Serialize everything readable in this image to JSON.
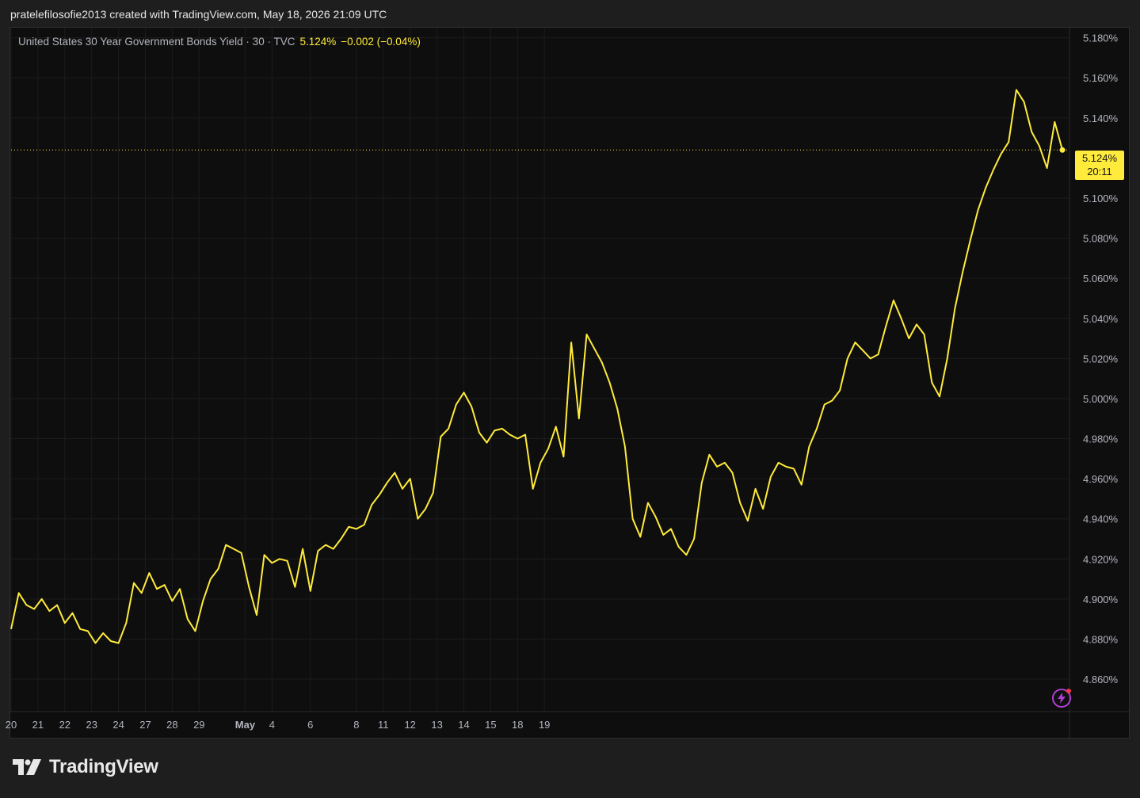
{
  "header": {
    "text": "pratelefilosofie2013 created with TradingView.com, May 18, 2026 21:09 UTC"
  },
  "legend": {
    "symbol": "United States 30 Year Government Bonds Yield · 30 · TVC",
    "last": "5.124%",
    "change": "−0.002 (−0.04%)"
  },
  "price_badge": {
    "price": "5.124%",
    "countdown": "20:11"
  },
  "brand": {
    "logo_text": "TradingView"
  },
  "colors": {
    "line": "#ffeb3b",
    "background": "#0e0e0e",
    "grid": "#1c1c1c",
    "axis_text": "#b2b5be"
  },
  "chart_data": {
    "type": "line",
    "title": "United States 30 Year Government Bonds Yield · 30 · TVC",
    "ylabel": "",
    "xlabel": "",
    "ylim": [
      4.845,
      5.185
    ],
    "grid": true,
    "y_ticks": [
      "5.180%",
      "5.160%",
      "5.140%",
      "5.100%",
      "5.080%",
      "5.060%",
      "5.040%",
      "5.020%",
      "5.000%",
      "4.980%",
      "4.960%",
      "4.940%",
      "4.920%",
      "4.900%",
      "4.880%",
      "4.860%"
    ],
    "y_tick_values": [
      5.18,
      5.16,
      5.14,
      5.1,
      5.08,
      5.06,
      5.04,
      5.02,
      5.0,
      4.98,
      4.96,
      4.94,
      4.92,
      4.9,
      4.88,
      4.86
    ],
    "x_ticks": [
      "20",
      "21",
      "22",
      "23",
      "24",
      "27",
      "28",
      "29",
      "May",
      "4",
      "6",
      "8",
      "11",
      "12",
      "13",
      "14",
      "15",
      "18",
      "19"
    ],
    "x_tick_index": [
      0,
      3.5,
      7,
      10.5,
      14,
      17.5,
      21,
      24.5,
      30.5,
      34,
      39,
      45,
      48.5,
      52,
      55.5,
      59,
      62.5,
      66,
      69.5
    ],
    "series": [
      {
        "values": [
          4.885,
          4.903,
          4.897,
          4.895,
          4.9,
          4.894,
          4.897,
          4.888,
          4.893,
          4.885,
          4.884,
          4.878,
          4.883,
          4.879,
          4.878,
          4.888,
          4.908,
          4.903,
          4.913,
          4.905,
          4.907,
          4.899,
          4.905,
          4.89,
          4.884,
          4.899,
          4.91,
          4.915,
          4.927,
          4.925,
          4.923,
          4.906,
          4.892,
          4.922,
          4.918,
          4.92,
          4.919,
          4.906,
          4.925,
          4.904,
          4.924,
          4.927,
          4.925,
          4.93,
          4.936,
          4.935,
          4.937,
          4.947,
          4.952,
          4.958,
          4.963,
          4.955,
          4.96,
          4.94,
          4.945,
          4.953,
          4.981,
          4.985,
          4.997,
          5.003,
          4.996,
          4.983,
          4.978,
          4.984,
          4.985,
          4.982,
          4.98,
          4.982,
          4.955,
          4.968,
          4.975,
          4.986,
          4.971,
          5.028,
          4.99,
          5.032,
          5.025,
          5.018,
          5.008,
          4.995,
          4.976,
          4.94,
          4.931,
          4.948,
          4.941,
          4.932,
          4.935,
          4.926,
          4.922,
          4.93,
          4.958,
          4.972,
          4.966,
          4.968,
          4.963,
          4.948,
          4.939,
          4.955,
          4.945,
          4.961,
          4.968,
          4.966,
          4.965,
          4.957,
          4.976,
          4.985,
          4.997,
          4.999,
          5.004,
          5.02,
          5.028,
          5.024,
          5.02,
          5.022,
          5.036,
          5.049,
          5.04,
          5.03,
          5.037,
          5.032,
          5.008,
          5.001,
          5.02,
          5.045,
          5.063,
          5.079,
          5.094,
          5.105,
          5.114,
          5.122,
          5.128,
          5.154,
          5.148,
          5.133,
          5.126,
          5.115,
          5.138,
          5.124
        ]
      }
    ]
  }
}
